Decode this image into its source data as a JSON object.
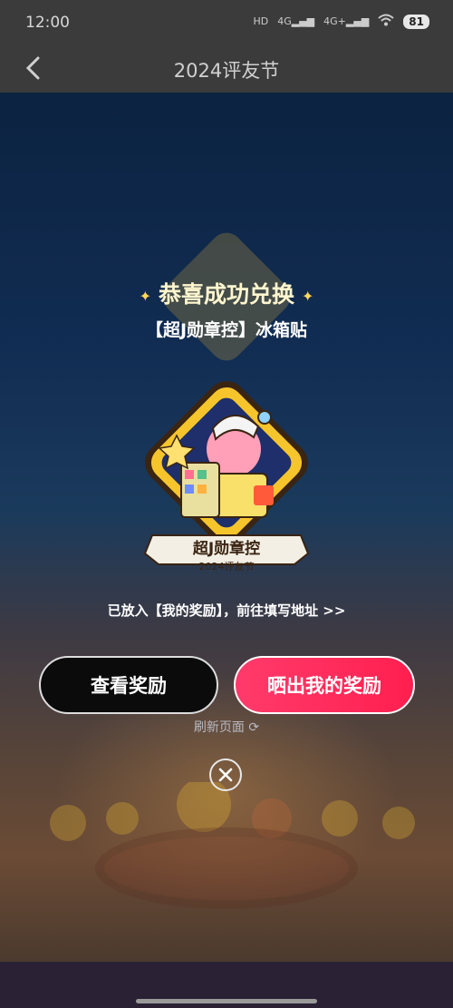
{
  "status_bar": {
    "time": "12:00",
    "network_1": "4G",
    "network_2": "4G+",
    "battery": "81"
  },
  "header": {
    "title": "2024评友节"
  },
  "modal": {
    "congrats": "恭喜成功兑换",
    "prize_name": "【超J勋章控】冰箱贴",
    "badge": {
      "ribbon_text": "超J勋章控",
      "sub_text": "2024评友节"
    },
    "added_text": "已放入【我的奖励】，前往填写地址 >>",
    "view_button": "查看奖励",
    "share_button": "晒出我的奖励",
    "refresh_text": "刷新页面",
    "colors": {
      "share_button": "#ff2d5c",
      "view_button": "#0b0b0b",
      "accent_gold": "#ffd75a"
    }
  }
}
